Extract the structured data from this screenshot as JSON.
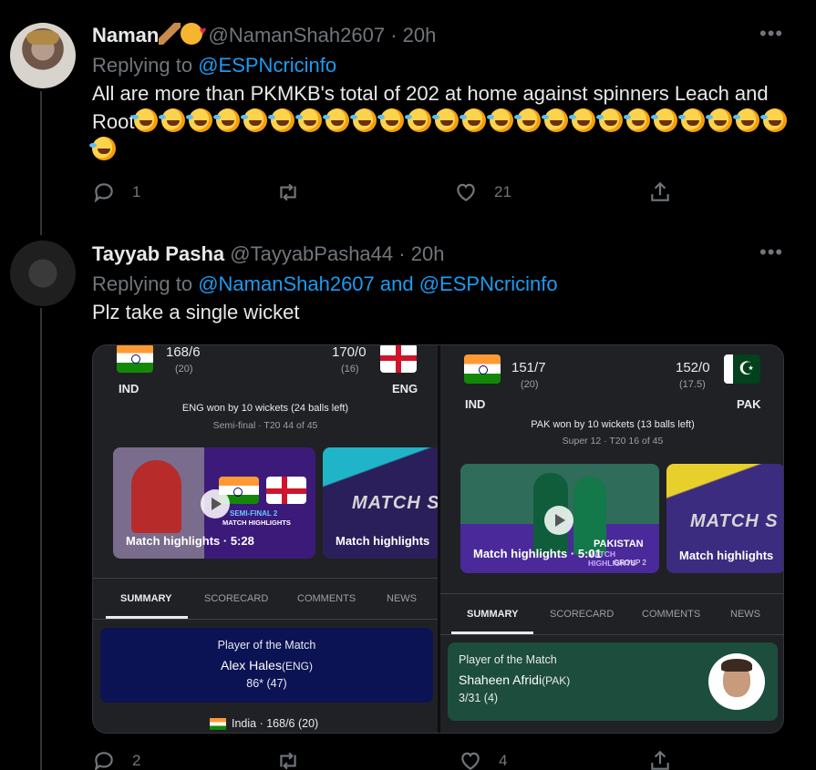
{
  "tweet1": {
    "name": "Naman",
    "handle": "@NamanShah2607",
    "time": "20h",
    "replying_label": "Replying to",
    "replying_to": "@ESPNcricinfo",
    "text": "All are more than PKMKB's total of 202 at home against spinners Leach and Root",
    "laugh_count": 25,
    "reply_count": "1",
    "like_count": "21"
  },
  "tweet2": {
    "name": "Tayyab Pasha",
    "handle": "@TayyabPasha44",
    "time": "20h",
    "replying_label": "Replying to",
    "replying_to": "@NamanShah2607 and @ESPNcricinfo",
    "text": "Plz take a single wicket",
    "reply_count": "2",
    "like_count": "4"
  },
  "card_left": {
    "team1": "IND",
    "team1_score": "168/6",
    "team1_overs": "(20)",
    "team2": "ENG",
    "team2_score": "170/0",
    "team2_overs": "(16)",
    "result": "ENG won by 10 wickets (24 balls left)",
    "sub": "Semi-final · T20 44 of 45",
    "video1_label": "Match highlights  ·  5:28",
    "video1_banner_title": "SEMI-FINAL 2",
    "video1_banner_sub": "MATCH HIGHLIGHTS",
    "video2_label": "Match highlights",
    "video2_art": "MATCH S",
    "tabs": [
      "SUMMARY",
      "SCORECARD",
      "COMMENTS",
      "NEWS"
    ],
    "potm_label": "Player of the Match",
    "potm_name": "Alex Hales",
    "potm_team": "(ENG)",
    "potm_stat": "86* (47)",
    "footer": "India · 168/6 (20)"
  },
  "card_right": {
    "team1": "IND",
    "team1_score": "151/7",
    "team1_overs": "(20)",
    "team2": "PAK",
    "team2_score": "152/0",
    "team2_overs": "(17.5)",
    "result": "PAK won by 10 wickets (13 balls left)",
    "sub": "Super 12 · T20 16 of 45",
    "video1_label": "Match highlights  ·  5:01",
    "video1_banner_title": "PAKISTAN",
    "video1_banner_sub": "MATCH HIGHLIGHTS",
    "video1_group": "GROUP 2",
    "video2_label": "Match highlights",
    "video2_art": "MATCH S",
    "tabs": [
      "SUMMARY",
      "SCORECARD",
      "COMMENTS",
      "NEWS"
    ],
    "potm_label": "Player of the Match",
    "potm_name": "Shaheen Afridi",
    "potm_team": "(PAK)",
    "potm_stat": "3/31 (4)"
  },
  "icons": {
    "more": "more-icon",
    "reply": "reply-icon",
    "retweet": "retweet-icon",
    "like": "like-icon",
    "share": "share-icon"
  },
  "colors": {
    "background": "#000000",
    "text": "#e7e9ea",
    "muted": "#71767b",
    "link": "#1d9bf0",
    "potm_eng_bg": "#0b1354",
    "potm_pak_bg": "#1d4d3c"
  }
}
